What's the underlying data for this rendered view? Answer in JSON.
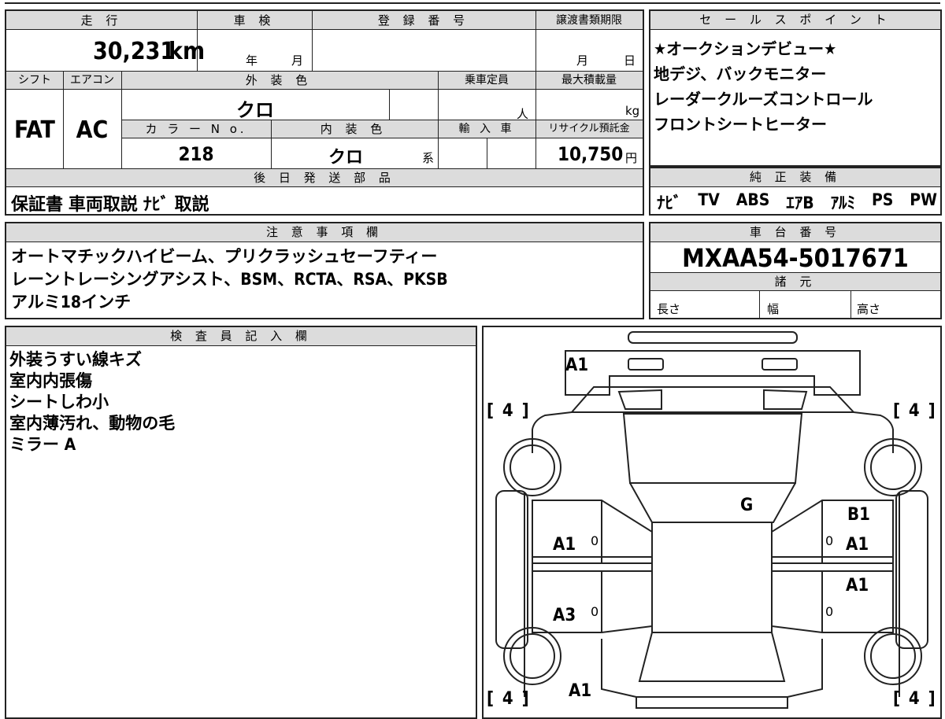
{
  "main": {
    "labels": {
      "mileage": "走 行",
      "inspection": "車 検",
      "registration": "登 録 番 号",
      "transfer_deadline": "譲渡書類期限",
      "shift": "シフト",
      "aircon": "エアコン",
      "exterior_color": "外 装 色",
      "capacity": "乗車定員",
      "max_load": "最大積載量",
      "color_no": "カ ラ ー N o.",
      "interior_color": "内 装 色",
      "import": "輸 入 車",
      "recycle_fee": "リサイクル預託金"
    },
    "values": {
      "mileage": "30,231",
      "mileage_unit": "km",
      "year_unit": "年",
      "month_unit": "月",
      "deadline_month": "月",
      "deadline_day": "日",
      "shift": "FAT",
      "aircon": "AC",
      "exterior_color": "クロ",
      "capacity_unit": "人",
      "load_unit": "kg",
      "color_no": "218",
      "interior_color": "クロ",
      "interior_suffix": "系",
      "recycle_fee": "10,750",
      "yen": "円"
    },
    "later_parts": {
      "label": "後 日 発 送 部 品",
      "value": "保証書  車両取説  ﾅﾋﾞ 取説"
    }
  },
  "sales_points": {
    "label": "セ ー ル ス ポ イ ン ト",
    "lines": [
      "★オークションデビュー★",
      "地デジ、バックモニター",
      "レーダークルーズコントロール",
      "フロントシートヒーター"
    ]
  },
  "equipment": {
    "label": "純 正 装 備",
    "items": [
      "ﾅﾋﾞ",
      "TV",
      "ABS",
      "ｴｱB",
      "ｱﾙﾐ",
      "PS",
      "PW"
    ]
  },
  "notes": {
    "label": "注 意 事 項 欄",
    "lines": [
      "オートマチックハイビーム、プリクラッシュセーフティー",
      "レーントレーシングアシスト、BSM、RCTA、RSA、PKSB",
      "アルミ18インチ"
    ]
  },
  "chassis": {
    "label": "車 台 番 号",
    "value": "MXAA54-5017671",
    "spec_label": "諸 元",
    "length": "長さ",
    "width": "幅",
    "height": "高さ"
  },
  "inspector": {
    "label": "検 査 員 記 入 欄",
    "lines": [
      "外装うすい線キズ",
      "室内内張傷",
      "シートしわ小",
      "室内薄汚れ、動物の毛",
      "ミラー A"
    ]
  },
  "diagram": {
    "tire_marks": [
      "[ 4 ]",
      "[ 4 ]",
      "[ 4 ]",
      "[ 4 ]"
    ],
    "damage": {
      "front_bumper": "A1",
      "windshield": "G",
      "right_front_fender": "B1",
      "left_front_door": "A1",
      "right_front_door": "A1",
      "right_rear_door": "A1",
      "left_rear_door": "A3",
      "rear": "A1"
    },
    "zero_marks": [
      "0",
      "0",
      "0",
      "0"
    ]
  }
}
